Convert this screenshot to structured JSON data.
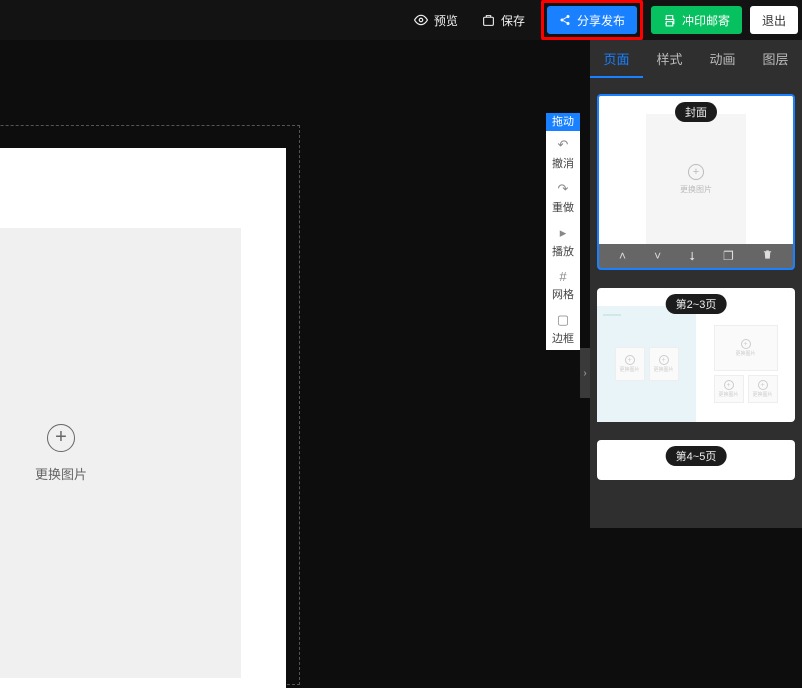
{
  "header": {
    "preview": "预览",
    "save": "保存",
    "share": "分享发布",
    "print": "冲印邮寄",
    "exit": "退出"
  },
  "canvas": {
    "placeholder_label": "更换图片"
  },
  "side_tools": {
    "drag_badge": "拖动",
    "undo": "撤消",
    "redo": "重做",
    "play": "播放",
    "grid": "网格",
    "border": "边框"
  },
  "panel": {
    "tabs": {
      "page": "页面",
      "style": "样式",
      "animation": "动画",
      "layer": "图层"
    },
    "pages": {
      "cover_label": "封面",
      "cover_placeholder": "更换图片",
      "spread1_label": "第2~3页",
      "spread2_label": "第4~5页",
      "img_placeholder": "更换图片"
    }
  }
}
